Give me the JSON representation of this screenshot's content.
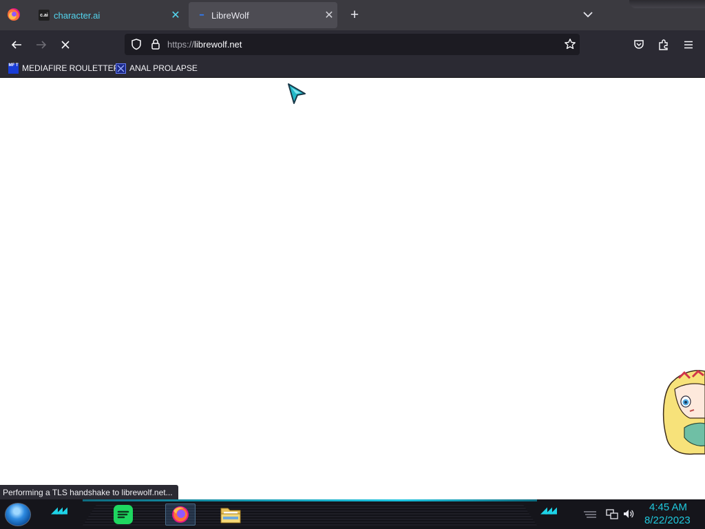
{
  "browser": {
    "tabs": [
      {
        "title": "character.ai",
        "favicon": "character-ai-icon",
        "favicon_text": "c.ai",
        "active": false
      },
      {
        "title": "LibreWolf",
        "favicon": "librewolf-icon",
        "active": true
      }
    ],
    "url": {
      "protocol": "https://",
      "host": "librewolf.net"
    },
    "bookmarks": [
      {
        "label": "MEDIAFIRE ROULETTER",
        "icon": "mediafire-icon",
        "icon_text": "MF T"
      },
      {
        "label": "ANAL PROLAPSE",
        "icon": "bookmark-icon"
      }
    ],
    "status": "Performing a TLS handshake to librewolf.net..."
  },
  "taskbar": {
    "apps": [
      "spotify-icon",
      "firefox-icon",
      "file-explorer-icon"
    ],
    "clock": {
      "time": "4:45 AM",
      "date": "8/22/2023"
    }
  },
  "colors": {
    "accent": "#1fc8dd",
    "toolbar": "#2b2a33",
    "tabstrip": "#3b3a40"
  }
}
